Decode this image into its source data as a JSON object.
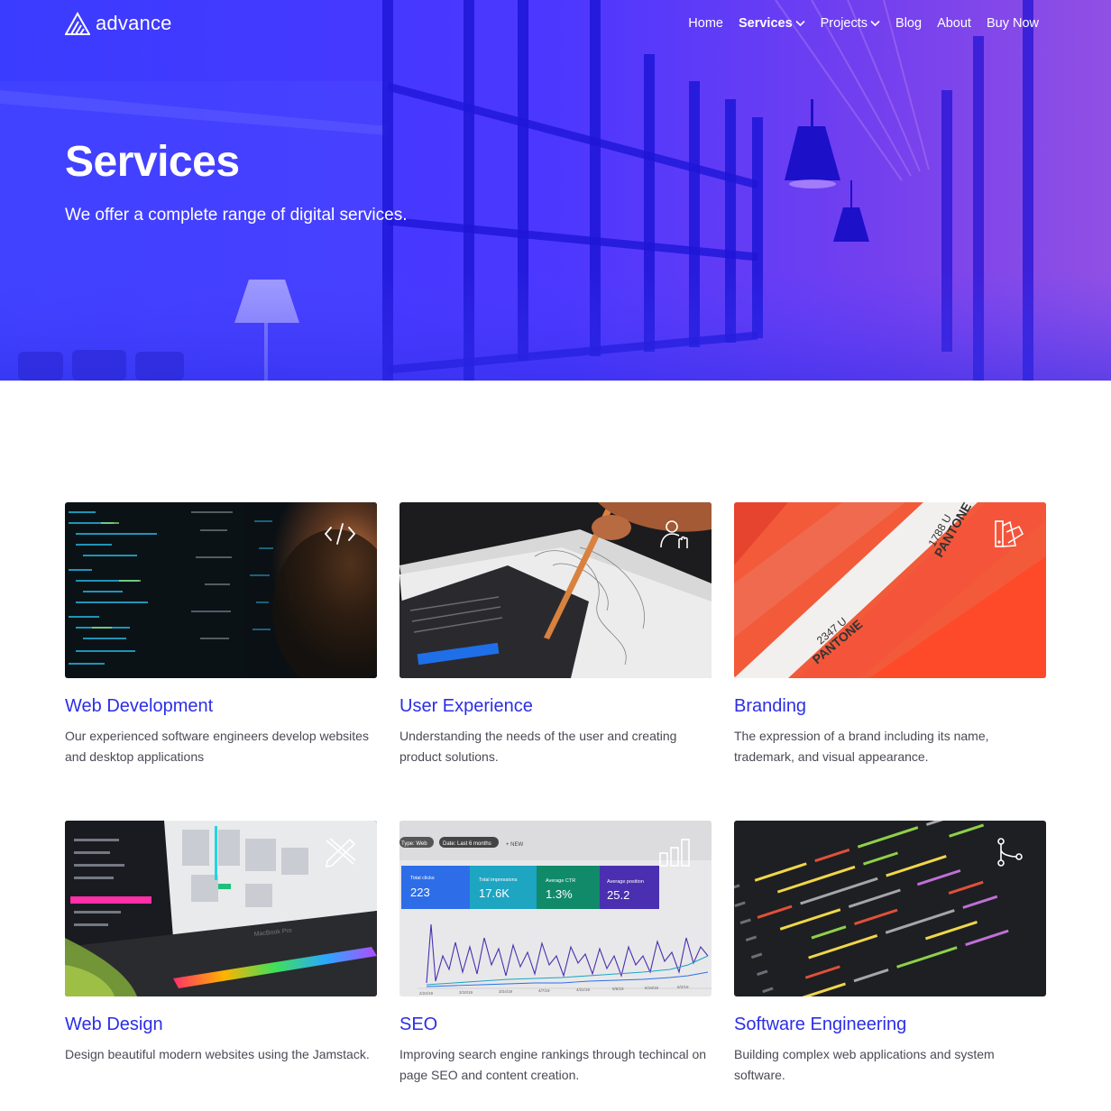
{
  "brand": {
    "name": "advance"
  },
  "nav": {
    "items": [
      {
        "label": "Home",
        "active": false,
        "dropdown": false
      },
      {
        "label": "Services",
        "active": true,
        "dropdown": true
      },
      {
        "label": "Projects",
        "active": false,
        "dropdown": true
      },
      {
        "label": "Blog",
        "active": false,
        "dropdown": false
      },
      {
        "label": "About",
        "active": false,
        "dropdown": false
      },
      {
        "label": "Buy Now",
        "active": false,
        "dropdown": false
      }
    ]
  },
  "hero": {
    "title": "Services",
    "subtitle": "We offer a complete range of digital services."
  },
  "services": [
    {
      "title": "Web Development",
      "description": "Our experienced software engineers develop websites and desktop applications",
      "icon": "code-icon"
    },
    {
      "title": "User Experience",
      "description": "Understanding the needs of the user and creating product solutions.",
      "icon": "user-hand-icon"
    },
    {
      "title": "Branding",
      "description": "The expression of a brand including its name, trademark, and visual appearance.",
      "icon": "color-swatch-icon"
    },
    {
      "title": "Web Design",
      "description": "Design beautiful modern websites using the Jamstack.",
      "icon": "pencil-ruler-icon"
    },
    {
      "title": "SEO",
      "description": "Improving search engine rankings through techincal on page SEO and content creation.",
      "icon": "bar-chart-icon"
    },
    {
      "title": "Software Engineering",
      "description": "Building complex web applications and system software.",
      "icon": "git-branch-icon"
    }
  ],
  "images": {
    "pantone": [
      "PANTONE",
      "1788 U",
      "PANTONE",
      "2347 U"
    ],
    "seo_dashboard": {
      "filters": [
        "Type: Web",
        "Date: Last 6 months",
        "+ NEW"
      ],
      "metrics": [
        {
          "label": "Total clicks",
          "value": "223"
        },
        {
          "label": "Total impressions",
          "value": "17.6K"
        },
        {
          "label": "Average CTR",
          "value": "1.3%"
        },
        {
          "label": "Average position",
          "value": "25.2"
        }
      ],
      "dates": [
        "2/24/19",
        "3/10/19",
        "3/24/19",
        "4/7/19",
        "4/21/19",
        "5/5/19",
        "5/19/19",
        "6/2/19"
      ]
    },
    "laptop_label": "MacBook Pro"
  },
  "colors": {
    "accent": "#2b2ee6",
    "hero_start": "#3a3dff",
    "hero_end": "#8b4de8"
  }
}
